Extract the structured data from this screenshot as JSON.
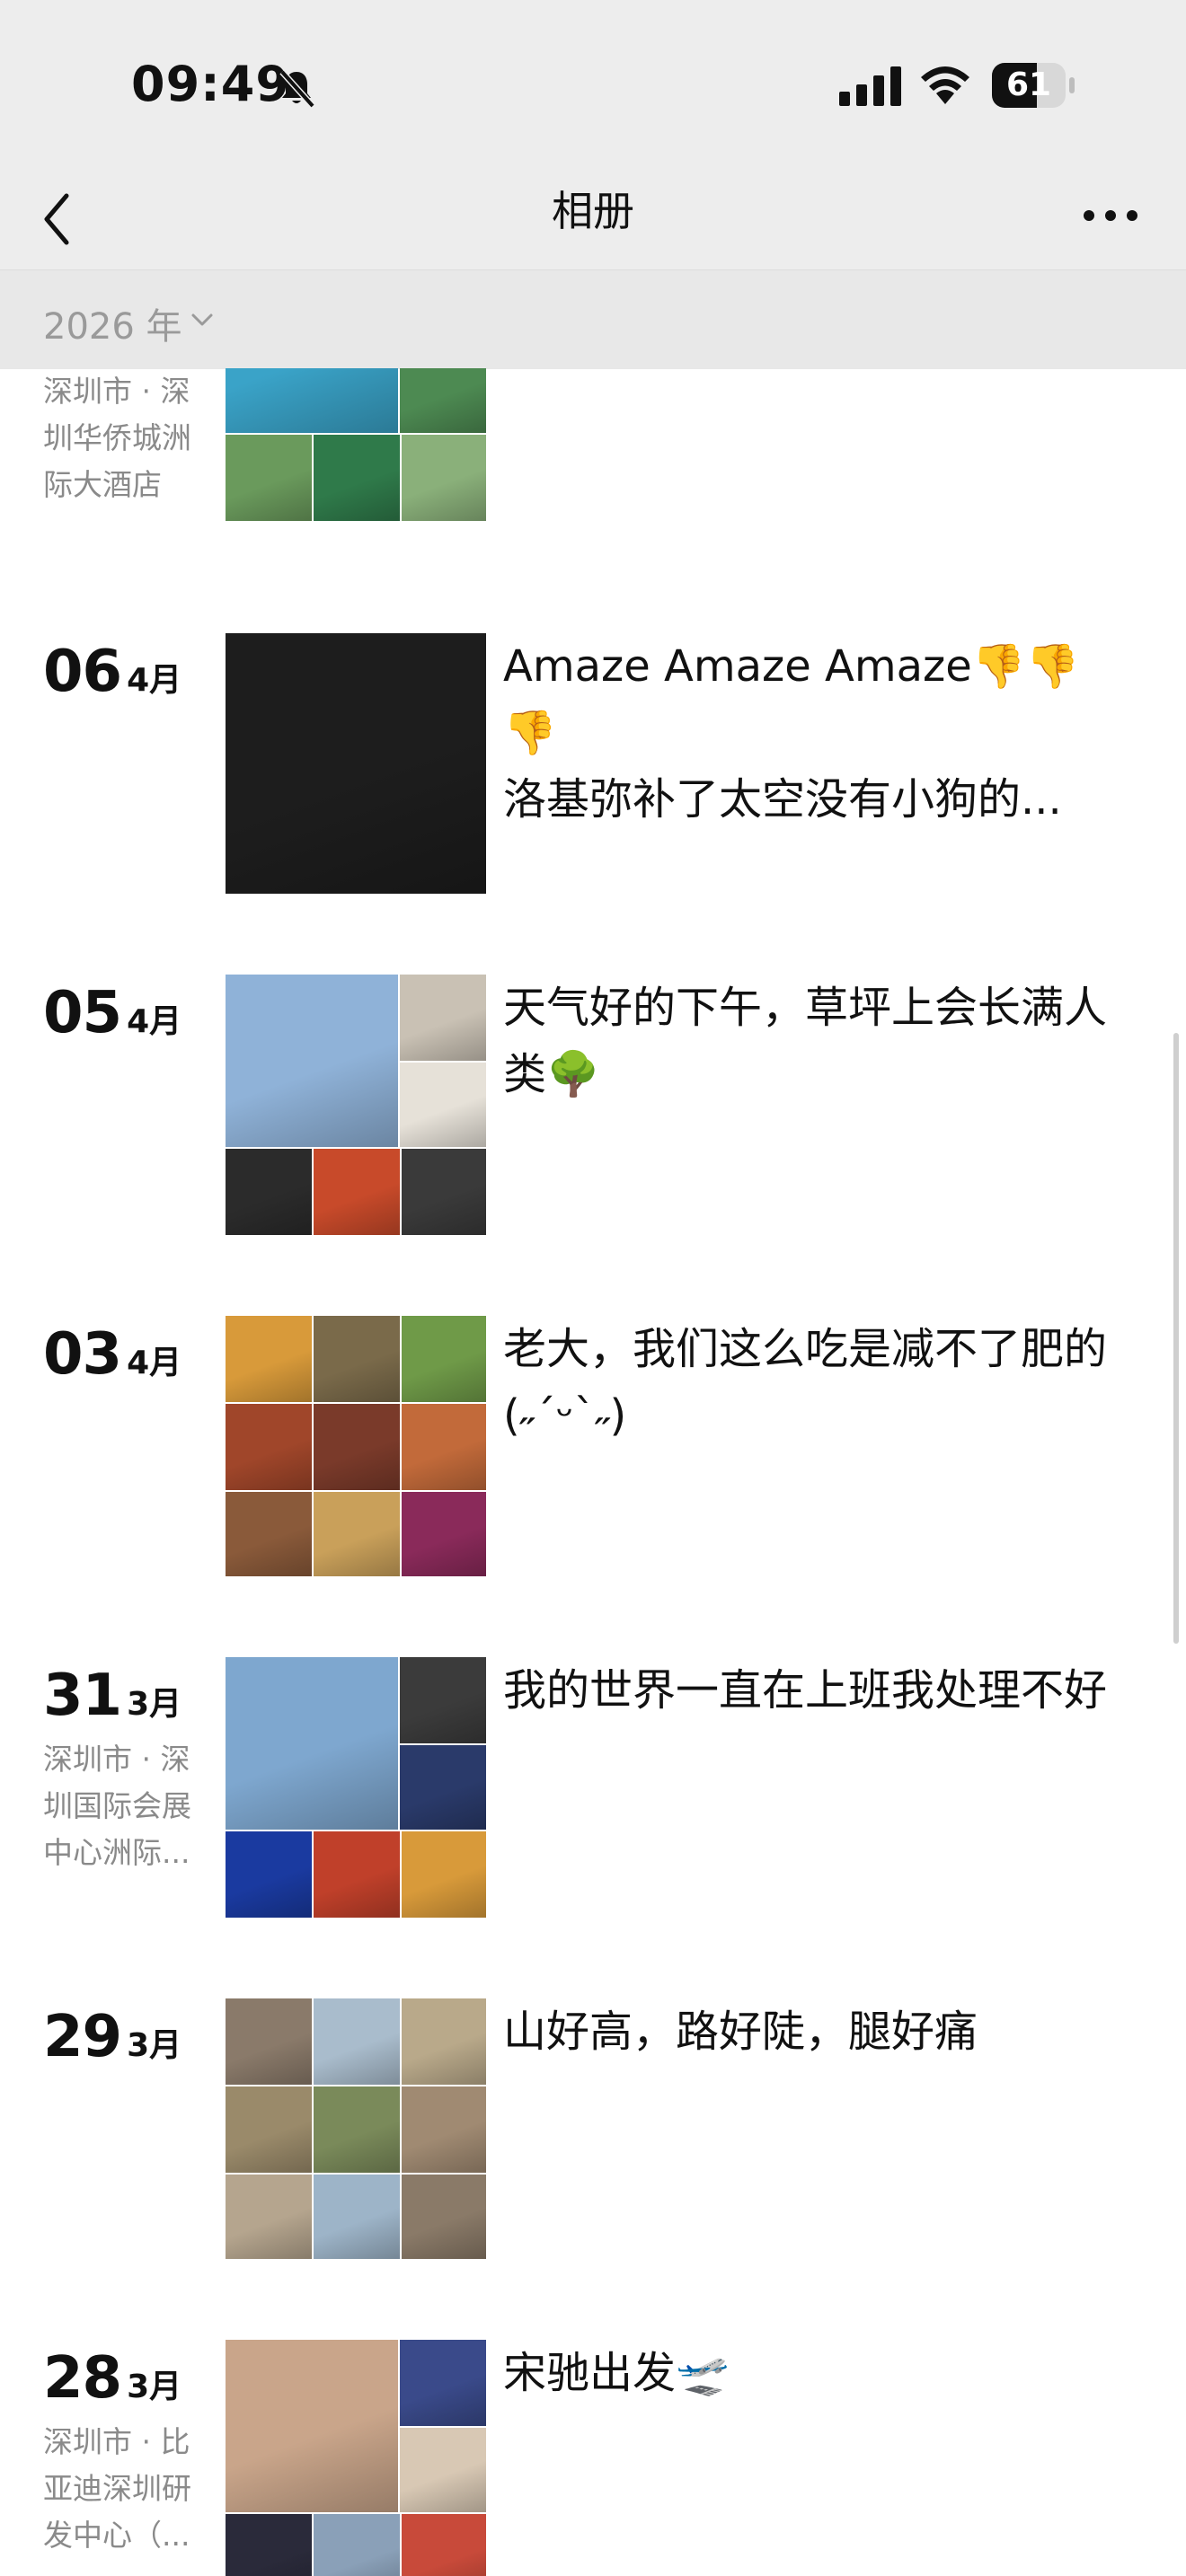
{
  "status_bar": {
    "time": "09:49",
    "battery_level": "61",
    "battery_fraction": 0.61
  },
  "nav": {
    "title": "相册"
  },
  "year_filter": {
    "label": "2026 年"
  },
  "posts": [
    {
      "day": "",
      "month": "",
      "location": "深圳市 · 深圳华侨城洲际大酒店",
      "caption": "",
      "thumb_palette": [
        "#3aa3c8",
        "#d9e7ee",
        "#4d8a52",
        "#6a9a5c",
        "#2f7a4a",
        "#8ab07a",
        "#c8d6d0"
      ]
    },
    {
      "day": "06",
      "month": "4月",
      "location": "",
      "caption": "Amaze Amaze Amaze👎👎👎\n洛基弥补了太空没有小狗的...",
      "thumb_palette": [
        "#1d1d1d",
        "#3d4a55",
        "#c9b89a",
        "#6b5b4a"
      ]
    },
    {
      "day": "05",
      "month": "4月",
      "location": "",
      "caption": "天气好的下午，草坪上会长满人类🌳",
      "thumb_palette": [
        "#8fb2d8",
        "#c9c1b4",
        "#e6e1d8",
        "#2b2b2b",
        "#c84a2a",
        "#3a3a3a"
      ]
    },
    {
      "day": "03",
      "month": "4月",
      "location": "",
      "caption": "老大，我们这么吃是减不了肥的 (˶ˊᵕˋ˶)",
      "thumb_palette": [
        "#d89a3a",
        "#7a6a4a",
        "#6f9a48",
        "#a0462a",
        "#7a3a2a",
        "#c26a3a",
        "#8a5a3a",
        "#c9a05a",
        "#8a2a5a"
      ]
    },
    {
      "day": "31",
      "month": "3月",
      "location": "深圳市 · 深圳国际会展中心洲际...",
      "caption": "我的世界一直在上班我处理不好",
      "thumb_palette": [
        "#7ea7cf",
        "#3b3b3b",
        "#2a3a6a",
        "#1a3aa0",
        "#c0402a",
        "#d89a3a"
      ]
    },
    {
      "day": "29",
      "month": "3月",
      "location": "",
      "caption": "山好高，路好陡，腿好痛",
      "thumb_palette": [
        "#8a7a6a",
        "#a9bccc",
        "#b9a98a",
        "#9a8a6a",
        "#7a8a5a",
        "#a08a72",
        "#b5a58e",
        "#9db4c8",
        "#8a7a68"
      ]
    },
    {
      "day": "28",
      "month": "3月",
      "location": "深圳市 · 比亚迪深圳研发中心（...",
      "caption": "宋驰出发🛫",
      "thumb_palette": [
        "#c9a58a",
        "#3a4a8a",
        "#d8c8b4",
        "#2a2a3a",
        "#8aa0b8",
        "#c84a3a"
      ]
    }
  ]
}
